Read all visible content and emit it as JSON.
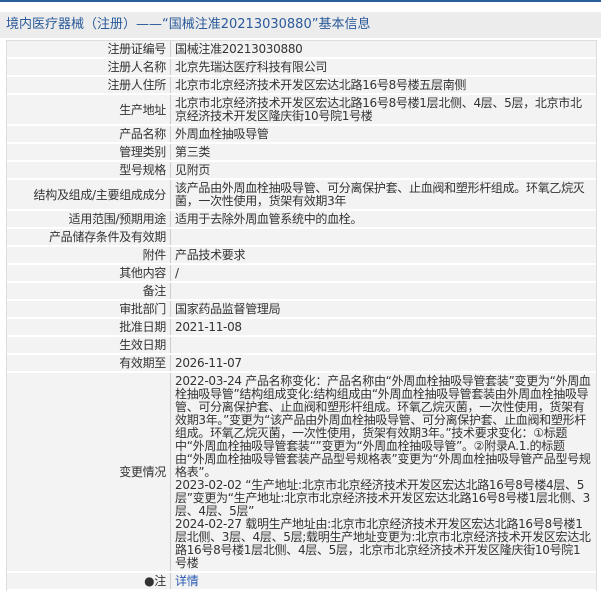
{
  "title": "境内医疗器械（注册）——“国械注准20213030880”基本信息",
  "rows": [
    {
      "label": "注册证编号",
      "value": "国械注准20213030880"
    },
    {
      "label": "注册人名称",
      "value": "北京先瑞达医疗科技有限公司"
    },
    {
      "label": "注册人住所",
      "value": "北京市北京经济技术开发区宏达北路16号8号楼五层南侧"
    },
    {
      "label": "生产地址",
      "value": "北京市北京经济技术开发区宏达北路16号8号楼1层北侧、4层、5层，北京市北京经济技术开发区隆庆街10号院1号楼"
    },
    {
      "label": "产品名称",
      "value": "外周血栓抽吸导管"
    },
    {
      "label": "管理类别",
      "value": "第三类"
    },
    {
      "label": "型号规格",
      "value": "见附页"
    },
    {
      "label": "结构及组成/主要组成成分",
      "value": "该产品由外周血栓抽吸导管、可分离保护套、止血阀和塑形杆组成。环氧乙烷灭菌，一次性使用，货架有效期3年"
    },
    {
      "label": "适用范围/预期用途",
      "value": "适用于去除外周血管系统中的血栓。"
    },
    {
      "label": "产品储存条件及有效期",
      "value": ""
    },
    {
      "label": "附件",
      "value": "产品技术要求"
    },
    {
      "label": "其他内容",
      "value": "/"
    },
    {
      "label": "备注",
      "value": ""
    },
    {
      "label": "审批部门",
      "value": "国家药品监督管理局"
    },
    {
      "label": "批准日期",
      "value": "2021-11-08"
    },
    {
      "label": "生效日期",
      "value": ""
    },
    {
      "label": "有效期至",
      "value": "2026-11-07"
    },
    {
      "label": "变更情况",
      "value": "2022-03-24 产品名称变化：产品名称由“外周血栓抽吸导管套装”变更为“外周血栓抽吸导管”结构组成变化:结构组成由“外周血栓抽吸导管套装由外周血栓抽吸导管、可分离保护套、止血阀和塑形杆组成。环氧乙烷灭菌，一次性使用，货架有效期3年。”变更为“该产品由外周血栓抽吸导管、可分离保护套、止血阀和塑形杆组成。环氧乙烷灭菌，一次性使用，货架有效期3年。”技术要求变化：①标题中“外周血栓抽吸导管套装“”变更为“外周血栓抽吸导管”。②附录A.1.的标题由“外周血栓抽吸导管套装产品型号规格表”变更为“外周血栓抽吸导管产品型号规格表”。\n2023-02-02 “生产地址:北京市北京经济技术开发区宏达北路16号8号楼4层、5层”变更为“生产地址:北京市北京经济技术开发区宏达北路16号8号楼1层北侧、3层、4层、5层”\n2024-02-27 载明生产地址由:北京市北京经济技术开发区宏达北路16号8号楼1层北侧、3层、4层、5层;载明生产地址变更为:北京市北京经济技术开发区宏达北路16号8号楼1层北侧、4层、5层，北京市北京经济技术开发区隆庆街10号院1号楼"
    },
    {
      "label": "●注",
      "value": "详情"
    }
  ]
}
